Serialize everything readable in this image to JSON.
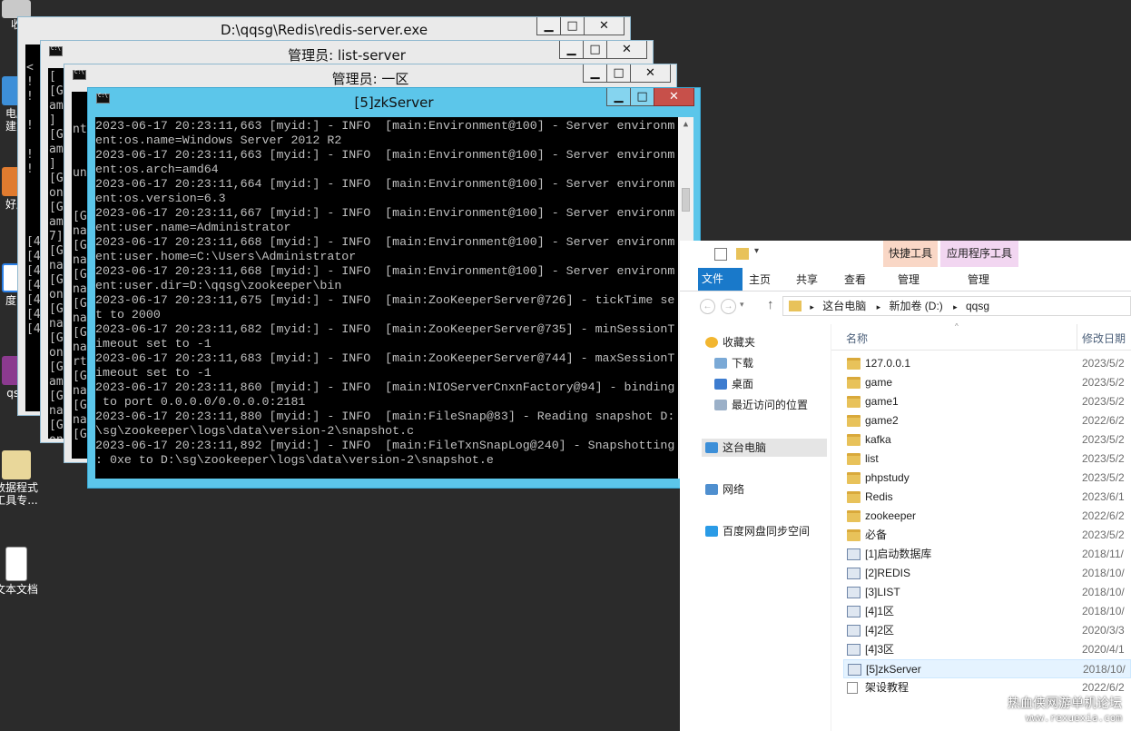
{
  "desktop": {
    "icons": [
      {
        "label": "收"
      },
      {
        "label": "电脑\n建方"
      },
      {
        "label": "好压"
      },
      {
        "label": "度网"
      },
      {
        "label": "qsg"
      },
      {
        "label": "数据程式\n工具专..."
      },
      {
        "label": "文本文档"
      }
    ]
  },
  "windows": {
    "redis": {
      "title": "D:\\qqsg\\Redis\\redis-server.exe",
      "side": "  \n<\n!\n!\n \n!\n \n!\n!\n \n \n \n \n[4\n[4\n[4\n[4\n[4\n[4\n[4"
    },
    "list": {
      "title": "管理员:  list-server",
      "side": "[\n[G\nam\n]\n[G\nam\n]\n[G\non\n[G\nam\n7]\n[G\nna\n[G\non\n[G\nna\n[G\non\n[G\nam\n[G\nna\n[G\non\n[G\nam"
    },
    "zone1": {
      "title": "管理员:  一区",
      "side": "\n\nnt\n\n\nun\n\n\n[G\nna\n[G\nna\n[G\nna\n[G\nna\n[G\nna\nrt\n[G\nna\n[G\nna\n[G"
    },
    "zk": {
      "title": "[5]zkServer",
      "log": [
        "2023-06-17 20:23:11,663 [myid:] - INFO  [main:Environment@100] - Server environm",
        "ent:os.name=Windows Server 2012 R2",
        "2023-06-17 20:23:11,663 [myid:] - INFO  [main:Environment@100] - Server environm",
        "ent:os.arch=amd64",
        "2023-06-17 20:23:11,664 [myid:] - INFO  [main:Environment@100] - Server environm",
        "ent:os.version=6.3",
        "2023-06-17 20:23:11,667 [myid:] - INFO  [main:Environment@100] - Server environm",
        "ent:user.name=Administrator",
        "2023-06-17 20:23:11,668 [myid:] - INFO  [main:Environment@100] - Server environm",
        "ent:user.home=C:\\Users\\Administrator",
        "2023-06-17 20:23:11,668 [myid:] - INFO  [main:Environment@100] - Server environm",
        "ent:user.dir=D:\\qqsg\\zookeeper\\bin",
        "2023-06-17 20:23:11,675 [myid:] - INFO  [main:ZooKeeperServer@726] - tickTime se",
        "t to 2000",
        "2023-06-17 20:23:11,682 [myid:] - INFO  [main:ZooKeeperServer@735] - minSessionT",
        "imeout set to -1",
        "2023-06-17 20:23:11,683 [myid:] - INFO  [main:ZooKeeperServer@744] - maxSessionT",
        "imeout set to -1",
        "2023-06-17 20:23:11,860 [myid:] - INFO  [main:NIOServerCnxnFactory@94] - binding",
        " to port 0.0.0.0/0.0.0.0:2181",
        "2023-06-17 20:23:11,880 [myid:] - INFO  [main:FileSnap@83] - Reading snapshot D:",
        "\\sg\\zookeeper\\logs\\data\\version-2\\snapshot.c",
        "2023-06-17 20:23:11,892 [myid:] - INFO  [main:FileTxnSnapLog@240] - Snapshotting",
        ": 0xe to D:\\sg\\zookeeper\\logs\\data\\version-2\\snapshot.e"
      ]
    }
  },
  "explorer": {
    "context_tabs": [
      "快捷工具",
      "应用程序工具"
    ],
    "ribbon_tabs": {
      "file": "文件",
      "home": "主页",
      "share": "共享",
      "view": "查看",
      "manage1": "管理",
      "manage2": "管理"
    },
    "address": [
      "这台电脑",
      "新加卷 (D:)",
      "qqsg"
    ],
    "nav": {
      "favorites": "收藏夹",
      "downloads": "下载",
      "desktop": "桌面",
      "recent": "最近访问的位置",
      "this_pc": "这台电脑",
      "network": "网络",
      "baidu": "百度网盘同步空间"
    },
    "columns": {
      "name": "名称",
      "date": "修改日期"
    },
    "files": [
      {
        "name": "127.0.0.1",
        "date": "2023/5/2",
        "type": "folder"
      },
      {
        "name": "game",
        "date": "2023/5/2",
        "type": "folder"
      },
      {
        "name": "game1",
        "date": "2023/5/2",
        "type": "folder"
      },
      {
        "name": "game2",
        "date": "2022/6/2",
        "type": "folder"
      },
      {
        "name": "kafka",
        "date": "2023/5/2",
        "type": "folder"
      },
      {
        "name": "list",
        "date": "2023/5/2",
        "type": "folder"
      },
      {
        "name": "phpstudy",
        "date": "2023/5/2",
        "type": "folder"
      },
      {
        "name": "Redis",
        "date": "2023/6/1",
        "type": "folder"
      },
      {
        "name": "zookeeper",
        "date": "2022/6/2",
        "type": "folder"
      },
      {
        "name": "必备",
        "date": "2023/5/2",
        "type": "folder"
      },
      {
        "name": "[1]启动数据库",
        "date": "2018/11/",
        "type": "bat"
      },
      {
        "name": "[2]REDIS",
        "date": "2018/10/",
        "type": "bat"
      },
      {
        "name": "[3]LIST",
        "date": "2018/10/",
        "type": "bat"
      },
      {
        "name": "[4]1区",
        "date": "2018/10/",
        "type": "bat"
      },
      {
        "name": "[4]2区",
        "date": "2020/3/3",
        "type": "bat"
      },
      {
        "name": "[4]3区",
        "date": "2020/4/1",
        "type": "bat"
      },
      {
        "name": "[5]zkServer",
        "date": "2018/10/",
        "type": "bat"
      },
      {
        "name": "架设教程",
        "date": "2022/6/2",
        "type": "doc"
      }
    ]
  },
  "watermark": {
    "line1": "热血侠网游单机论坛",
    "line2": "www.rexuexia.com"
  }
}
